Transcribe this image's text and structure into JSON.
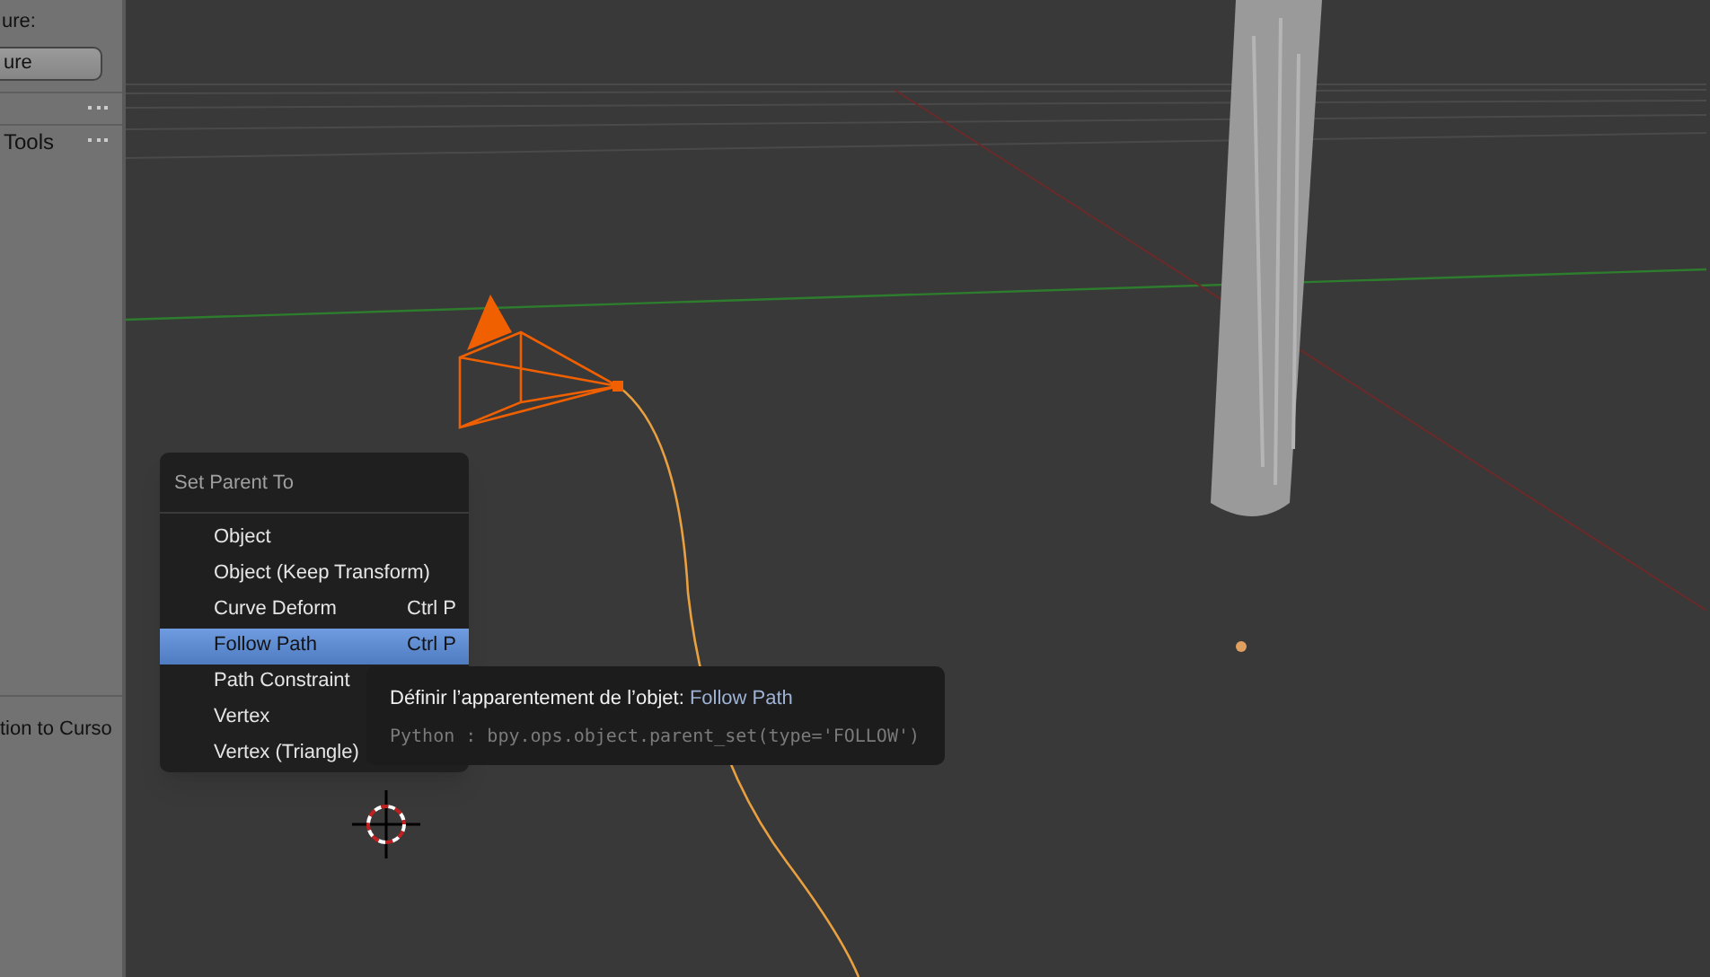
{
  "tool_panel": {
    "label": "ure:",
    "button": "ure",
    "tools_header": "Tools",
    "cut_item": "tion to Curso"
  },
  "menu": {
    "title": "Set Parent To",
    "items": [
      {
        "label": "Object",
        "selected": false
      },
      {
        "label": "Object (Keep Transform)",
        "selected": false
      },
      {
        "label": "Curve Deform",
        "shortcut": "Ctrl P",
        "selected": false
      },
      {
        "label": "Follow Path",
        "shortcut": "Ctrl P",
        "selected": true
      },
      {
        "label": "Path Constraint",
        "selected": false
      },
      {
        "label": "Vertex",
        "selected": false
      },
      {
        "label": "Vertex (Triangle)",
        "selected": false
      }
    ]
  },
  "tooltip": {
    "description": "Définir l’apparentement de l’objet:",
    "value": "Follow Path",
    "python": "Python : bpy.ops.object.parent_set(type='FOLLOW')"
  }
}
